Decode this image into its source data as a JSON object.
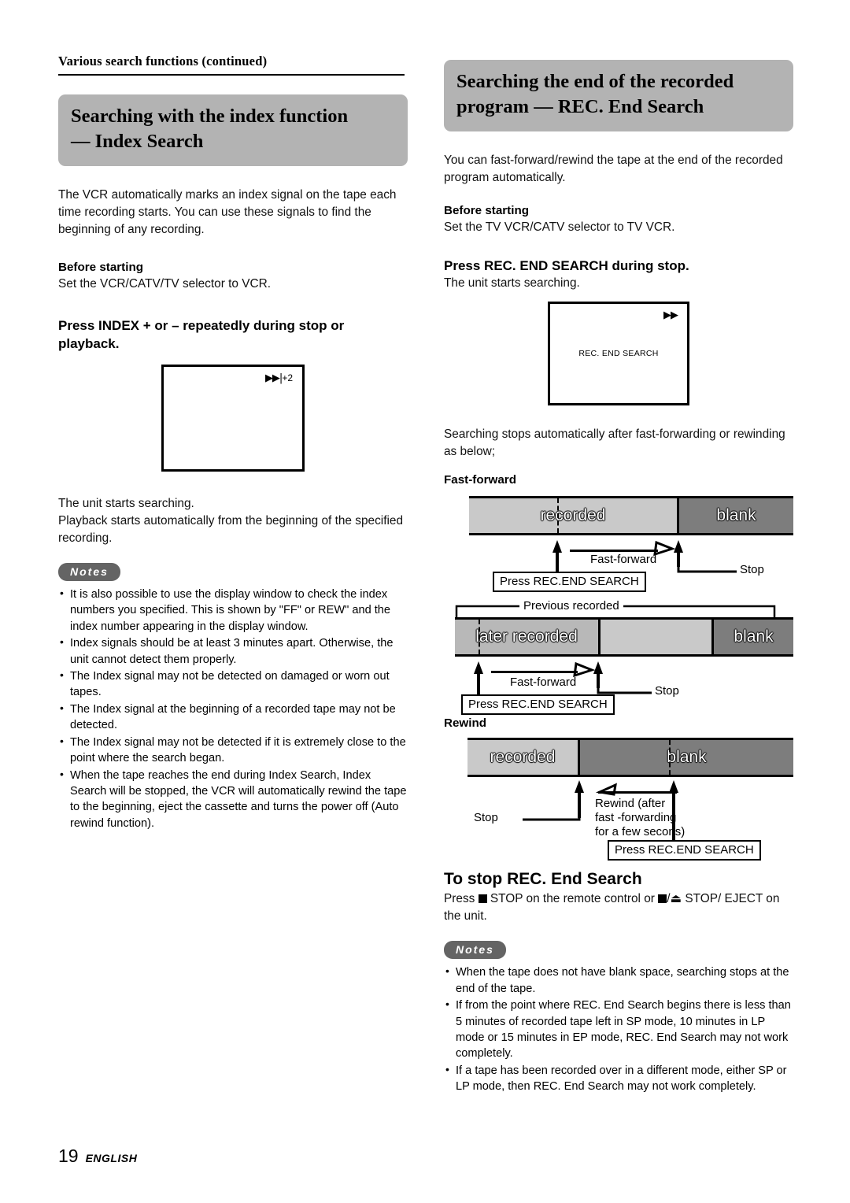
{
  "page": {
    "running_head": "Various search functions (continued)",
    "footer_page_number": "19",
    "footer_language": "ENGLISH"
  },
  "left_column": {
    "banner": {
      "line1": "Searching with the index function",
      "line2": "— Index Search"
    },
    "intro": "The VCR automatically marks an index signal on the tape each time recording starts. You can use these signals to find the beginning of any recording.",
    "before_starting_label": "Before starting",
    "before_starting_text": "Set the VCR/CATV/TV selector to VCR.",
    "step_heading": "Press INDEX + or – repeatedly during stop or playback.",
    "tv_screen": {
      "osd_icon": "▶▶|",
      "osd_value": "+2"
    },
    "after_text_1": "The unit starts searching.",
    "after_text_2": "Playback starts automatically from the beginning of the specified recording.",
    "notes_label": "Notes",
    "notes": [
      "It is also possible to use the display window to check the index numbers you specified. This is shown by \"FF\" or REW\" and the index number appearing in the display window.",
      "Index signals should be at least 3 minutes apart. Otherwise, the unit cannot detect them properly.",
      "The Index signal may not be detected on damaged or worn out tapes.",
      "The Index signal at the beginning of a recorded tape may not be detected.",
      "The Index signal may not be detected if it is extremely close to the point where the search began.",
      "When the tape reaches the end during Index Search, Index Search will be stopped, the VCR will automatically rewind the tape to the beginning, eject the cassette and turns the power off (Auto rewind function)."
    ]
  },
  "right_column": {
    "banner": {
      "line1": "Searching the end of the recorded",
      "line2": "program — REC. End Search"
    },
    "intro": "You can fast-forward/rewind the tape at the end of the recorded program automatically.",
    "before_starting_label": "Before starting",
    "before_starting_text": "Set the TV VCR/CATV selector to TV VCR.",
    "step_heading": "Press REC. END SEARCH during stop.",
    "step_sub": "The unit starts searching.",
    "tv_screen": {
      "osd_icon": "▶▶",
      "osd_text": "REC. END SEARCH"
    },
    "after_text": "Searching stops automatically after fast-forwarding or rewinding as below;",
    "diagram_fastforward": {
      "title": "Fast-forward",
      "segments": [
        {
          "label": "recorded",
          "shade": "light"
        },
        {
          "label": "blank",
          "shade": "dark"
        }
      ],
      "arrow_label": "Fast-forward",
      "press_label": "Press REC.END SEARCH",
      "stop_label": "Stop"
    },
    "diagram_later_recorded": {
      "bracket_label": "Previous recorded",
      "segments": [
        {
          "label": "later recorded",
          "shade": "mid"
        },
        {
          "label": "",
          "shade": "light"
        },
        {
          "label": "blank",
          "shade": "dark"
        }
      ],
      "arrow_label": "Fast-forward",
      "press_label": "Press REC.END SEARCH",
      "stop_label": "Stop"
    },
    "diagram_rewind": {
      "title": "Rewind",
      "segments": [
        {
          "label": "recorded",
          "shade": "light"
        },
        {
          "label": "blank",
          "shade": "dark"
        }
      ],
      "arrow_label_line1": "Rewind (after",
      "arrow_label_line2": "fast -forwarding",
      "arrow_label_line3": "for a few secons)",
      "press_label": "Press REC.END SEARCH",
      "stop_label": "Stop"
    },
    "stop_heading": "To stop REC. End Search",
    "stop_text_part1": "Press",
    "stop_text_part2": "STOP on the remote control or",
    "stop_text_part3": "/",
    "stop_text_part4": "STOP/",
    "stop_text_part5": "EJECT on the unit.",
    "eject_symbol": "⏏",
    "notes_label": "Notes",
    "notes": [
      "When the tape does not have blank space, searching stops at the end of the tape.",
      "If from the point where REC. End Search begins there is less than 5 minutes of recorded tape left in SP mode, 10 minutes in LP mode or 15 minutes in EP mode, REC. End Search may not work completely.",
      "If a tape has been recorded over in a different mode, either SP or LP mode, then REC. End Search may not work completely."
    ]
  },
  "colors": {
    "banner_bg": "#b3b3b3",
    "notes_badge_bg": "#646464",
    "tape_light": "#c9c9c9",
    "tape_mid": "#b8b8b8",
    "tape_dark": "#7d7d7d"
  }
}
